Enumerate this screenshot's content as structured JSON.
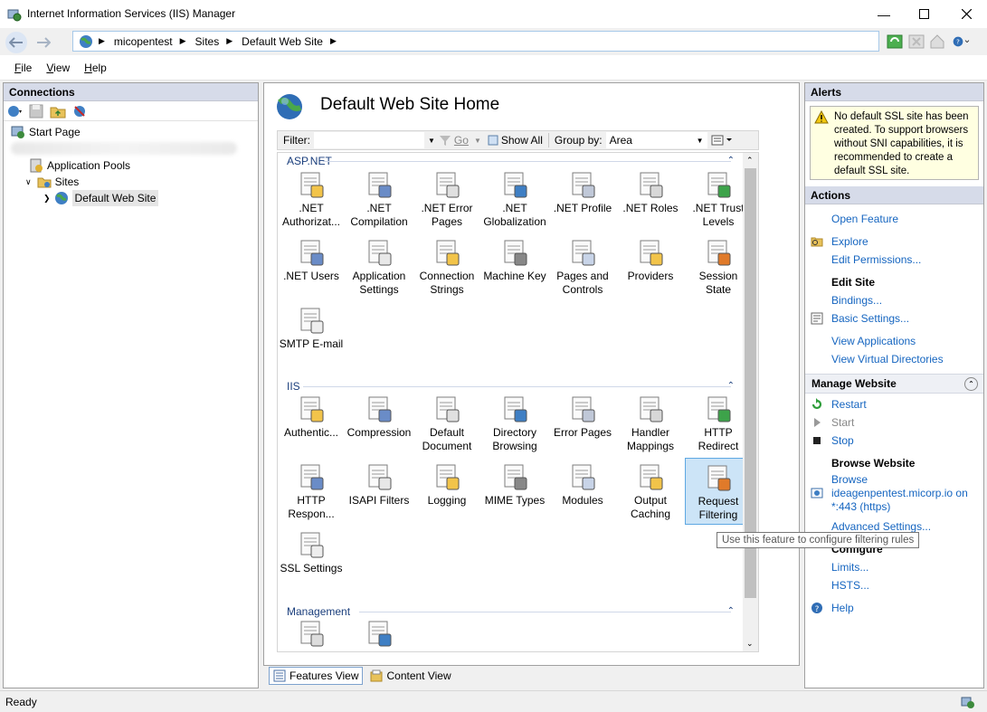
{
  "window": {
    "title": "Internet Information Services (IIS) Manager"
  },
  "address": {
    "crumbs": [
      "micopentest",
      "Sites",
      "Default Web Site"
    ]
  },
  "menu": {
    "file": "File",
    "view": "View",
    "help": "Help"
  },
  "connections": {
    "title": "Connections",
    "tree": {
      "start_page": "Start Page",
      "app_pools": "Application Pools",
      "sites": "Sites",
      "default_site": "Default Web Site"
    }
  },
  "center": {
    "title": "Default Web Site Home",
    "filter_label": "Filter:",
    "filter_value": "",
    "go_label": "Go",
    "show_all": "Show All",
    "group_by_label": "Group by:",
    "group_by_value": "Area",
    "sections": {
      "aspnet": "ASP.NET",
      "iis": "IIS",
      "management": "Management"
    },
    "aspnet_features": [
      {
        "line1": ".NET",
        "line2": "Authorizat..."
      },
      {
        "line1": ".NET",
        "line2": "Compilation"
      },
      {
        "line1": ".NET Error",
        "line2": "Pages"
      },
      {
        "line1": ".NET",
        "line2": "Globalization"
      },
      {
        "line1": ".NET Profile",
        "line2": ""
      },
      {
        "line1": ".NET Roles",
        "line2": ""
      },
      {
        "line1": ".NET Trust",
        "line2": "Levels"
      },
      {
        "line1": ".NET Users",
        "line2": ""
      },
      {
        "line1": "Application",
        "line2": "Settings"
      },
      {
        "line1": "Connection",
        "line2": "Strings"
      },
      {
        "line1": "Machine Key",
        "line2": ""
      },
      {
        "line1": "Pages and",
        "line2": "Controls"
      },
      {
        "line1": "Providers",
        "line2": ""
      },
      {
        "line1": "Session State",
        "line2": ""
      },
      {
        "line1": "SMTP E-mail",
        "line2": ""
      }
    ],
    "iis_features": [
      {
        "line1": "Authentic...",
        "line2": ""
      },
      {
        "line1": "Compression",
        "line2": ""
      },
      {
        "line1": "Default",
        "line2": "Document"
      },
      {
        "line1": "Directory",
        "line2": "Browsing"
      },
      {
        "line1": "Error Pages",
        "line2": ""
      },
      {
        "line1": "Handler",
        "line2": "Mappings"
      },
      {
        "line1": "HTTP",
        "line2": "Redirect"
      },
      {
        "line1": "HTTP",
        "line2": "Respon..."
      },
      {
        "line1": "ISAPI Filters",
        "line2": ""
      },
      {
        "line1": "Logging",
        "line2": ""
      },
      {
        "line1": "MIME Types",
        "line2": ""
      },
      {
        "line1": "Modules",
        "line2": ""
      },
      {
        "line1": "Output",
        "line2": "Caching"
      },
      {
        "line1": "Request",
        "line2": "Filtering"
      },
      {
        "line1": "SSL Settings",
        "line2": ""
      }
    ]
  },
  "view_tabs": {
    "features": "Features View",
    "content": "Content View"
  },
  "tooltip": "Use this feature to configure filtering rules",
  "alerts": {
    "title": "Alerts",
    "message": "No default SSL site has been created. To support browsers without SNI capabilities, it is recommended to create a default SSL site."
  },
  "actions": {
    "title": "Actions",
    "open_feature": "Open Feature",
    "explore": "Explore",
    "edit_permissions": "Edit Permissions...",
    "edit_site": "Edit Site",
    "bindings": "Bindings...",
    "basic_settings": "Basic Settings...",
    "view_applications": "View Applications",
    "view_virtual_dirs": "View Virtual Directories",
    "manage_website": "Manage Website",
    "restart": "Restart",
    "start": "Start",
    "stop": "Stop",
    "browse_website": "Browse Website",
    "browse_line1": "Browse",
    "browse_line2": "ideagenpentest.micorp.io on",
    "browse_line3": "*:443 (https)",
    "advanced_settings": "Advanced Settings...",
    "configure": "Configure",
    "limits": "Limits...",
    "hsts": "HSTS...",
    "help": "Help"
  },
  "status": {
    "text": "Ready"
  }
}
